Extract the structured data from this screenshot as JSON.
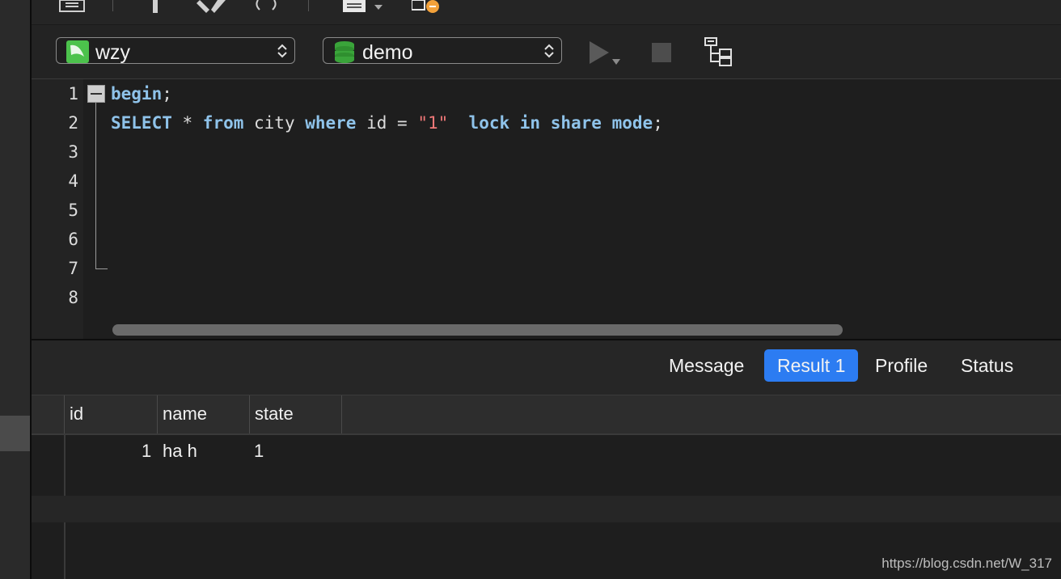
{
  "toolbar": {
    "icons": [
      "save-icon",
      "pin-icon",
      "tools-icon",
      "query-icon",
      "text-icon",
      "import-icon"
    ]
  },
  "selectors": {
    "connection": "wzy",
    "database": "demo"
  },
  "editor": {
    "line_numbers": [
      "1",
      "2",
      "3",
      "4",
      "5",
      "6",
      "7",
      "8"
    ],
    "line1": {
      "kw": "begin",
      "punct": ";"
    },
    "line2": {
      "t1": "SELECT",
      "t2": " * ",
      "t3": "from",
      "t4": " city ",
      "t5": "where",
      "t6": " id = ",
      "t7": "\"1\"",
      "t8": "  ",
      "t9": "lock",
      "t10": " ",
      "t11": "in",
      "t12": " ",
      "t13": "share",
      "t14": " ",
      "t15": "mode",
      "t16": ";"
    }
  },
  "result_tabs": {
    "message": "Message",
    "result1": "Result 1",
    "profile": "Profile",
    "status": "Status",
    "active": "Result 1"
  },
  "grid": {
    "columns": [
      "id",
      "name",
      "state"
    ],
    "rows": [
      {
        "id": "1",
        "name": "ha h",
        "state": "1"
      }
    ]
  },
  "watermark": "https://blog.csdn.net/W_317",
  "colors": {
    "keyword": "#8fc3ea",
    "string": "#f07878",
    "active_tab": "#2c7cf2",
    "db_icon": "#3aa43a",
    "conn_icon": "#4cc24c"
  }
}
